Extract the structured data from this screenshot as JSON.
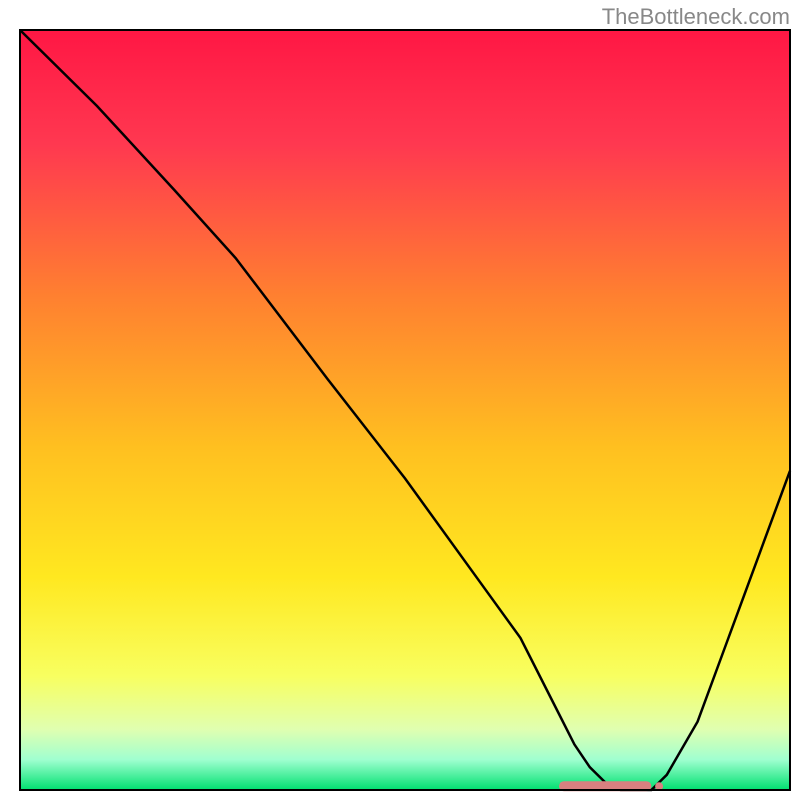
{
  "watermark": "TheBottleneck.com",
  "chart_data": {
    "type": "line",
    "title": "",
    "xlabel": "",
    "ylabel": "",
    "xlim": [
      0,
      100
    ],
    "ylim": [
      0,
      100
    ],
    "background_gradient": {
      "type": "vertical",
      "stops": [
        {
          "offset": 0,
          "color": "#ff1744"
        },
        {
          "offset": 15,
          "color": "#ff3850"
        },
        {
          "offset": 35,
          "color": "#ff8030"
        },
        {
          "offset": 55,
          "color": "#ffc020"
        },
        {
          "offset": 72,
          "color": "#ffe820"
        },
        {
          "offset": 85,
          "color": "#f8ff60"
        },
        {
          "offset": 92,
          "color": "#e0ffb0"
        },
        {
          "offset": 96,
          "color": "#a0ffd0"
        },
        {
          "offset": 100,
          "color": "#00e070"
        }
      ]
    },
    "series": [
      {
        "name": "bottleneck-curve",
        "color": "#000000",
        "x": [
          0,
          10,
          20,
          28,
          40,
          50,
          60,
          65,
          70,
          72,
          74,
          76,
          78,
          80,
          82,
          84,
          88,
          92,
          96,
          100
        ],
        "y": [
          100,
          90,
          79,
          70,
          54,
          41,
          27,
          20,
          10,
          6,
          3,
          1,
          0,
          0,
          0,
          2,
          9,
          20,
          31,
          42
        ]
      }
    ],
    "markers": {
      "name": "optimal-range",
      "color": "#d98080",
      "shape": "rounded-bar",
      "x_start": 70,
      "x_end": 82,
      "y": 0.5,
      "dot_at": 83
    },
    "grid": false,
    "legend": false
  }
}
